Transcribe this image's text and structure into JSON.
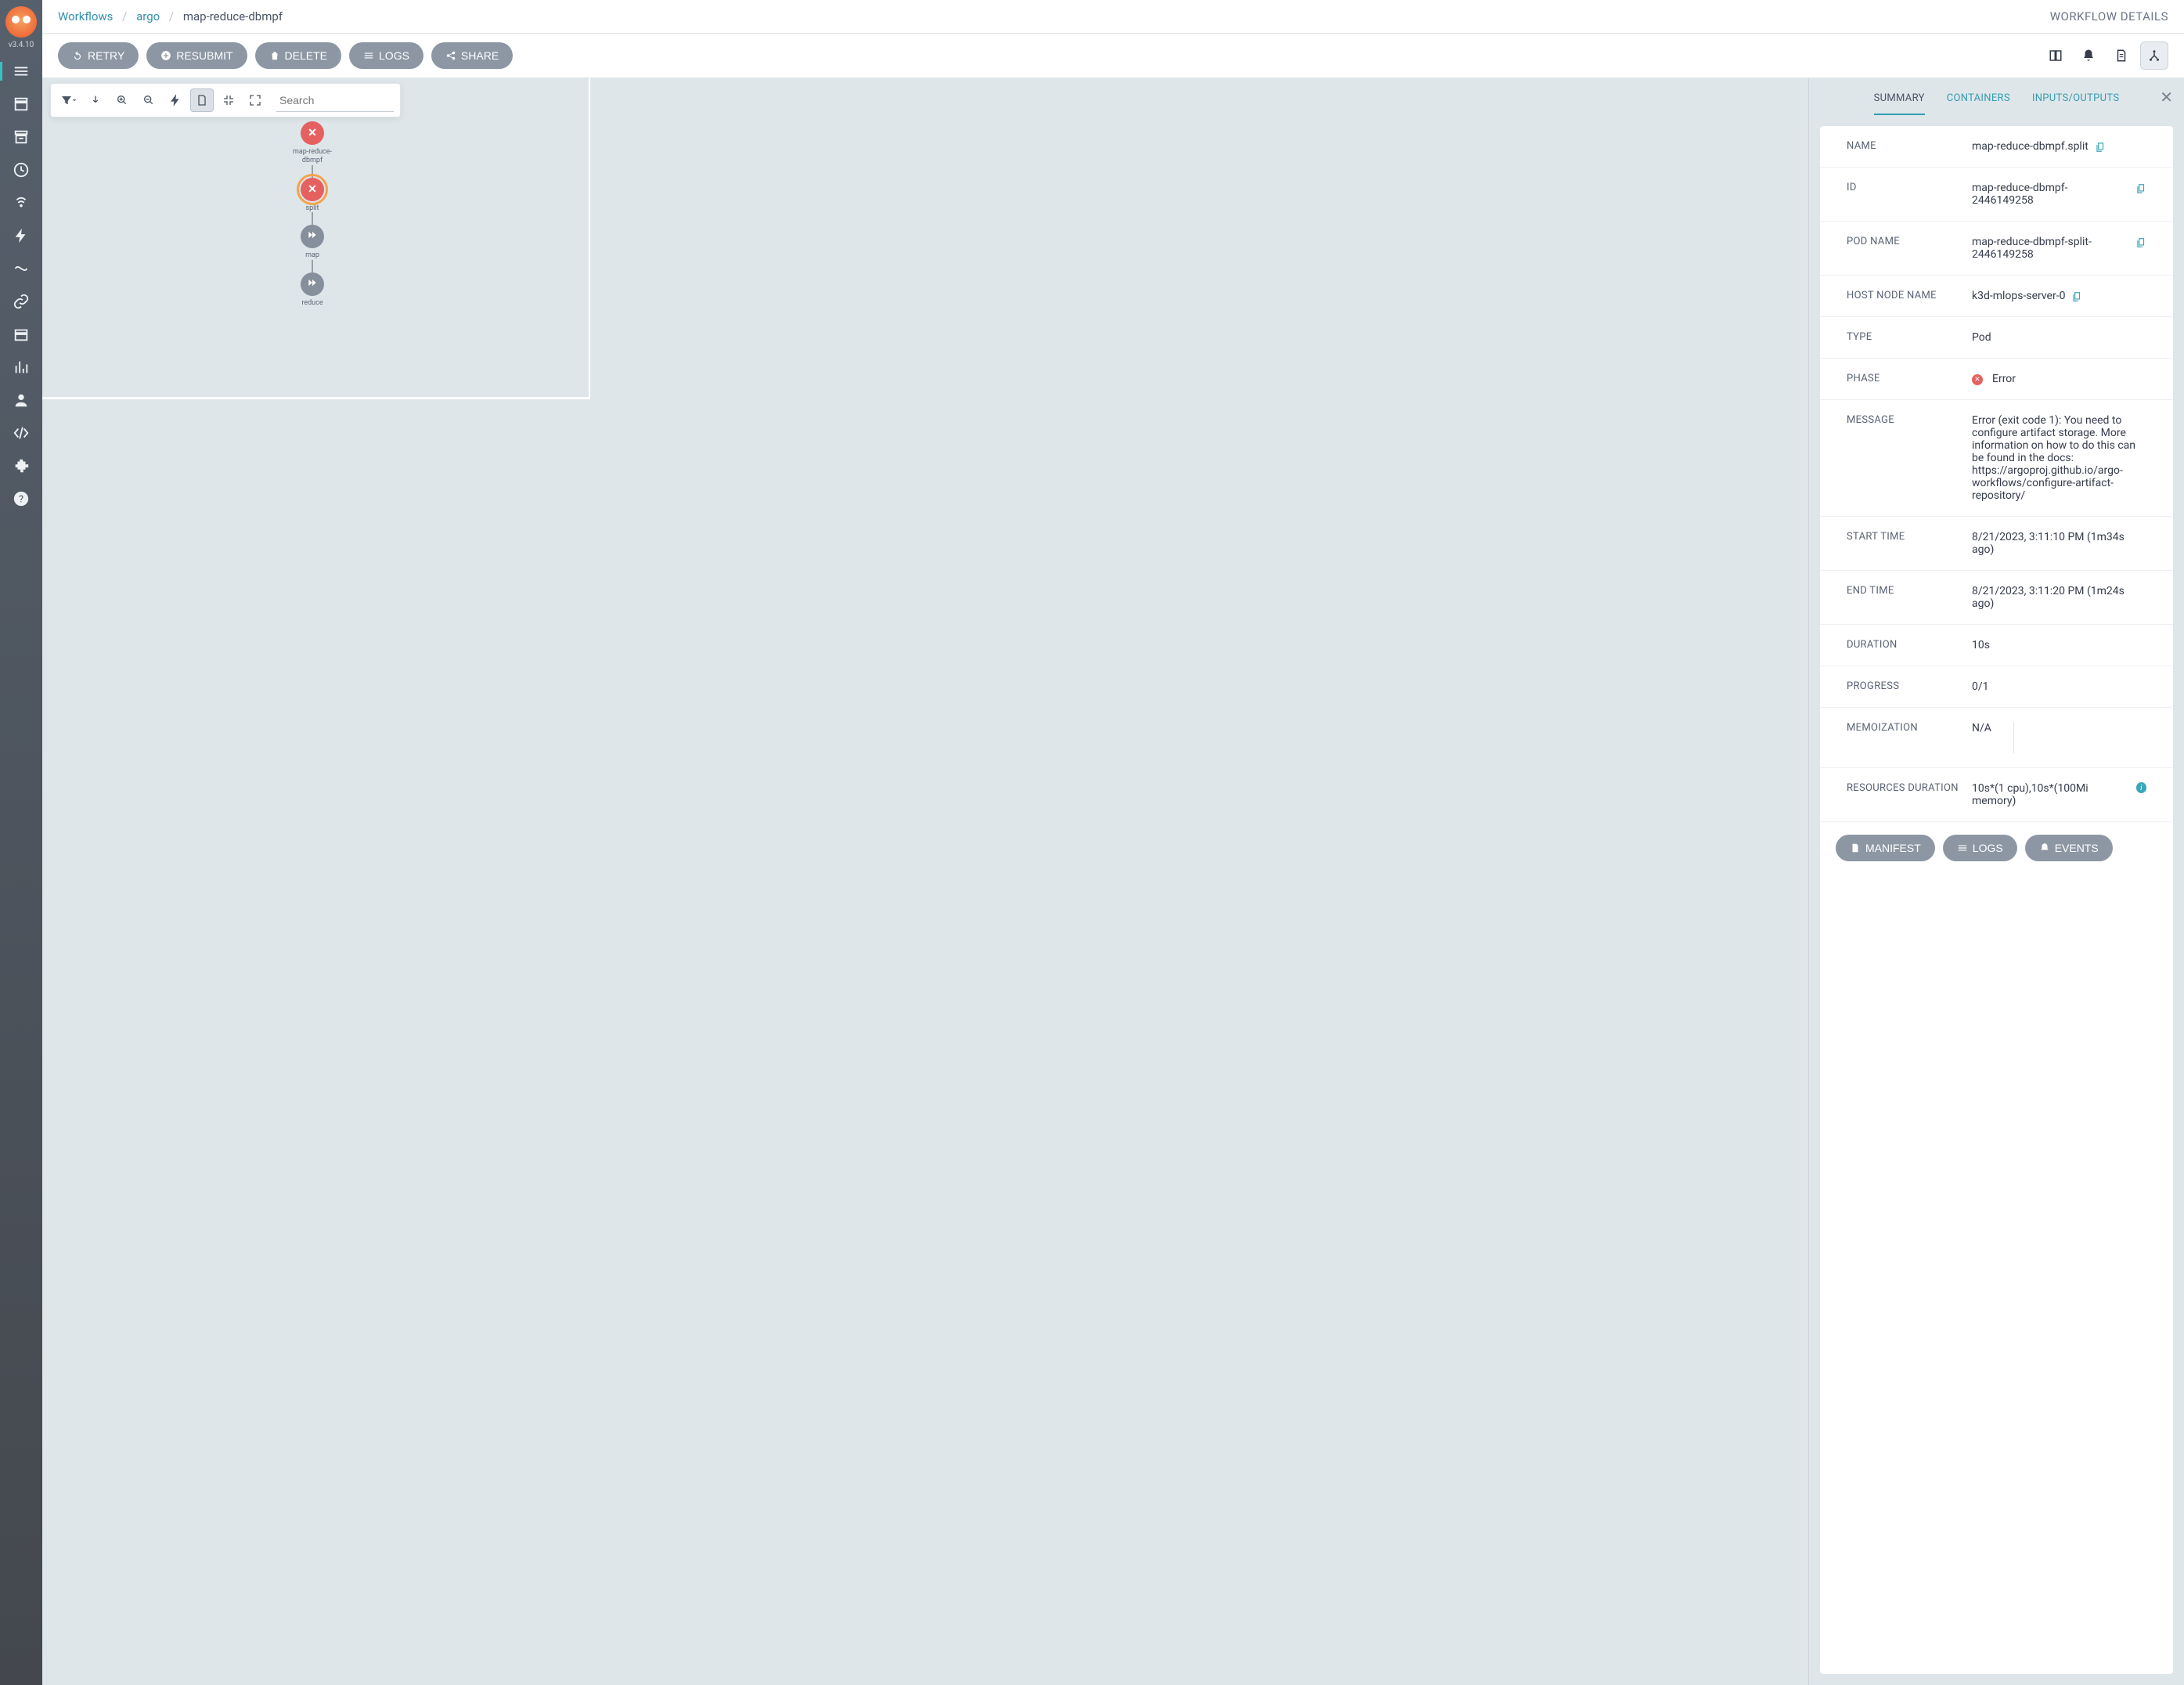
{
  "version": "v3.4.10",
  "breadcrumb": {
    "root": "Workflows",
    "ns": "argo",
    "wf": "map-reduce-dbmpf"
  },
  "header": {
    "subtitle": "WORKFLOW DETAILS"
  },
  "actions": {
    "retry": "RETRY",
    "resubmit": "RESUBMIT",
    "delete": "DELETE",
    "logs": "LOGS",
    "share": "SHARE"
  },
  "graphToolbar": {
    "search_placeholder": "Search"
  },
  "dag": {
    "root": "map-reduce-dbmpf",
    "split": "split",
    "map": "map",
    "reduce": "reduce"
  },
  "tabs": {
    "summary": "SUMMARY",
    "containers": "CONTAINERS",
    "io": "INPUTS/OUTPUTS"
  },
  "summary": {
    "labels": {
      "name": "NAME",
      "id": "ID",
      "pod": "POD NAME",
      "host": "HOST NODE NAME",
      "type": "TYPE",
      "phase": "PHASE",
      "message": "MESSAGE",
      "start": "START TIME",
      "end": "END TIME",
      "duration": "DURATION",
      "progress": "PROGRESS",
      "memo": "MEMOIZATION",
      "resdur": "RESOURCES DURATION"
    },
    "name": "map-reduce-dbmpf.split",
    "id": "map-reduce-dbmpf-2446149258",
    "pod": "map-reduce-dbmpf-split-2446149258",
    "host": "k3d-mlops-server-0",
    "type": "Pod",
    "phase": "Error",
    "message": "Error (exit code 1): You need to configure artifact storage. More information on how to do this can be found in the docs: https://argoproj.github.io/argo-workflows/configure-artifact-repository/",
    "start": "8/21/2023, 3:11:10 PM (1m34s ago)",
    "end": "8/21/2023, 3:11:20 PM (1m24s ago)",
    "duration": "10s",
    "progress": "0/1",
    "memo": "N/A",
    "resdur": "10s*(1 cpu),10s*(100Mi memory)"
  },
  "panelActions": {
    "manifest": "MANIFEST",
    "logs": "LOGS",
    "events": "EVENTS"
  }
}
